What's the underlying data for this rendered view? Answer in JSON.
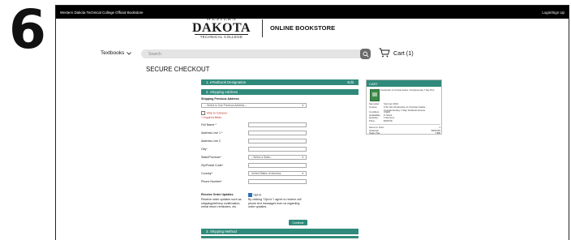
{
  "step": "6",
  "topbar": {
    "site_name": "Western Dakota Technical College Official Bookstore",
    "login": "Login/Sign Up"
  },
  "brand": {
    "logo_line1": "WESTERN",
    "logo_line2": "DAKOTA",
    "logo_line3": "TECHNICAL COLLEGE",
    "title": "ONLINE BOOKSTORE"
  },
  "nav": {
    "textbooks": "Textbooks",
    "search_placeholder": "Search",
    "cart_label": "Cart (1)"
  },
  "checkout": {
    "title": "SECURE CHECKOUT",
    "steps": [
      {
        "label": "1. eTextbook Designation",
        "status": "Edit"
      },
      {
        "label": "2. Shipping Address"
      },
      {
        "label": "3. Shipping Method"
      }
    ]
  },
  "form": {
    "prev_address_label": "Shipping Previous Address",
    "prev_address_value": "-- Select to Use Previous Address --",
    "ship_to_campus": "Ship to Campus",
    "required_note": "* required fields",
    "full_name": "Full Name *",
    "address1": "Address Line 1 *",
    "address2": "Address Line 2",
    "city": "City*",
    "state": "State/Province*",
    "state_value": "--Select a State--",
    "zip": "Zip/Postal Code*",
    "country": "Country*",
    "country_value": "United States of America",
    "phone": "Phone Number*",
    "updates_title": "Receive Order Updates",
    "updates_desc": "Receive order updates such as shipping/delivery confirmation, rental return reminders, etc.",
    "opt_in": "Opt-in",
    "opt_in_desc": "By clicking \"Opt-in\" I agree to receive cell phone text messages from us regarding order updates.",
    "continue": "Continue"
  },
  "cart": {
    "title": "CART",
    "book_title": "Introduction to Criminal Justice: Complementary 7 Day Print",
    "rows": [
      {
        "k": "Semester:",
        "v": "Summer 2021"
      },
      {
        "k": "Course:",
        "v": "CJS 101 Introduction to Criminal Justice - Complementary 7 Day Textbook Access"
      },
      {
        "k": "Condition:",
        "v": "USED"
      },
      {
        "k": "Availability:",
        "v": "In Stock"
      },
      {
        "k": "Quantity:",
        "v": "1 Remove"
      },
      {
        "k": "Price:",
        "v": "$165.59"
      }
    ],
    "items_label": "Items In Cart:",
    "items_value": "1",
    "subtotal_label": "Subtotal:",
    "subtotal_value": "$165.59",
    "tax_label": "Sales Tax:",
    "tax_value": "TBD"
  }
}
